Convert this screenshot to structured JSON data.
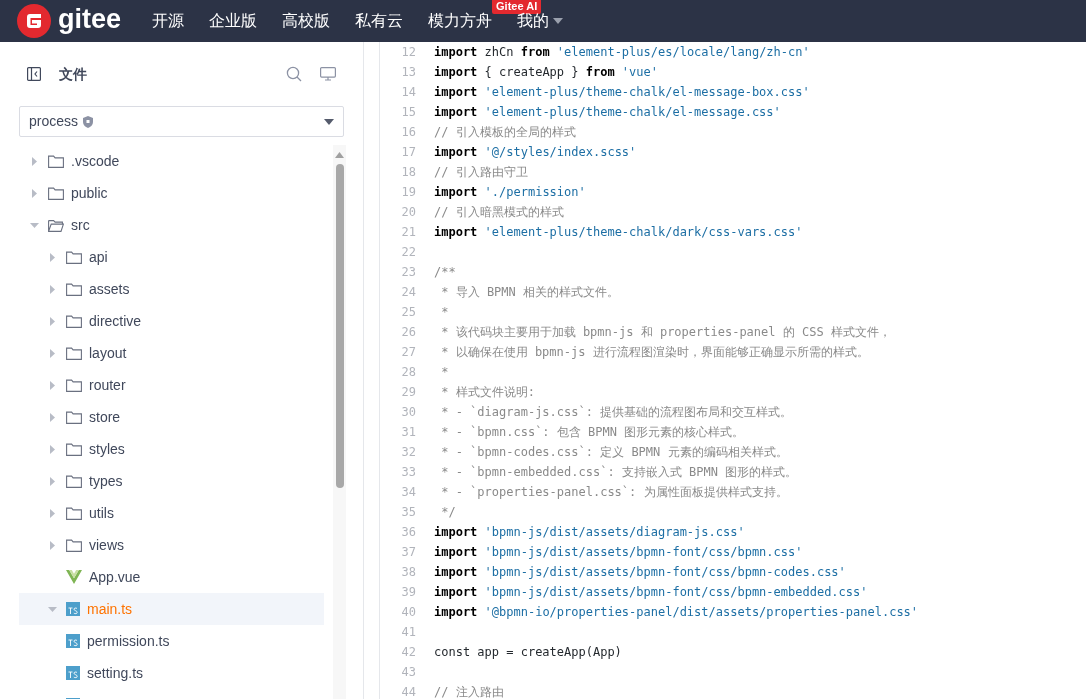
{
  "navbar": {
    "logo": "gitee",
    "items": [
      {
        "label": "开源"
      },
      {
        "label": "企业版"
      },
      {
        "label": "高校版"
      },
      {
        "label": "私有云"
      },
      {
        "label": "模力方舟",
        "badge": "Gitee AI"
      },
      {
        "label": "我的",
        "dropdown": true
      }
    ]
  },
  "sidebar": {
    "title": "文件",
    "branch": "process",
    "tree": [
      {
        "label": ".vscode",
        "kind": "folder",
        "expanded": false,
        "selected": false
      },
      {
        "label": "public",
        "kind": "folder",
        "expanded": false,
        "selected": false
      },
      {
        "label": "src",
        "kind": "folder",
        "expanded": true,
        "selected": false,
        "children": [
          {
            "label": "api",
            "kind": "folder",
            "expanded": false,
            "selected": false
          },
          {
            "label": "assets",
            "kind": "folder",
            "expanded": false,
            "selected": false
          },
          {
            "label": "directive",
            "kind": "folder",
            "expanded": false,
            "selected": false
          },
          {
            "label": "layout",
            "kind": "folder",
            "expanded": false,
            "selected": false
          },
          {
            "label": "router",
            "kind": "folder",
            "expanded": false,
            "selected": false
          },
          {
            "label": "store",
            "kind": "folder",
            "expanded": false,
            "selected": false
          },
          {
            "label": "styles",
            "kind": "folder",
            "expanded": false,
            "selected": false
          },
          {
            "label": "types",
            "kind": "folder",
            "expanded": false,
            "selected": false
          },
          {
            "label": "utils",
            "kind": "folder",
            "expanded": false,
            "selected": false
          },
          {
            "label": "views",
            "kind": "folder",
            "expanded": false,
            "selected": false
          },
          {
            "label": "App.vue",
            "kind": "vue",
            "selected": false
          },
          {
            "label": "main.ts",
            "kind": "ts",
            "expandable": true,
            "expanded": true,
            "selected": true
          },
          {
            "label": "permission.ts",
            "kind": "ts",
            "selected": false
          },
          {
            "label": "setting.ts",
            "kind": "ts",
            "selected": false
          },
          {
            "kind": "ts",
            "selected": false
          }
        ]
      }
    ]
  },
  "code": [
    {
      "number": "12",
      "tokens": [
        {
          "kind": "keyword",
          "text": "import"
        },
        {
          "kind": "plain",
          "text": " zhCn "
        },
        {
          "kind": "keyword",
          "text": "from"
        },
        {
          "kind": "string",
          "text": " 'element-plus/es/locale/lang/zh-cn'"
        }
      ]
    },
    {
      "number": "13",
      "tokens": [
        {
          "kind": "keyword",
          "text": "import"
        },
        {
          "kind": "plain",
          "text": " { createApp } "
        },
        {
          "kind": "keyword",
          "text": "from"
        },
        {
          "kind": "string",
          "text": " 'vue'"
        }
      ]
    },
    {
      "number": "14",
      "tokens": [
        {
          "kind": "keyword",
          "text": "import"
        },
        {
          "kind": "string",
          "text": " 'element-plus/theme-chalk/el-message-box.css'"
        }
      ]
    },
    {
      "number": "15",
      "tokens": [
        {
          "kind": "keyword",
          "text": "import"
        },
        {
          "kind": "string",
          "text": " 'element-plus/theme-chalk/el-message.css'"
        }
      ]
    },
    {
      "number": "16",
      "tokens": [
        {
          "kind": "comment",
          "text": "// 引入模板的全局的样式"
        }
      ]
    },
    {
      "number": "17",
      "tokens": [
        {
          "kind": "keyword",
          "text": "import"
        },
        {
          "kind": "string",
          "text": " '@/styles/index.scss'"
        }
      ]
    },
    {
      "number": "18",
      "tokens": [
        {
          "kind": "comment",
          "text": "// 引入路由守卫"
        }
      ]
    },
    {
      "number": "19",
      "tokens": [
        {
          "kind": "keyword",
          "text": "import"
        },
        {
          "kind": "string",
          "text": " './permission'"
        }
      ]
    },
    {
      "number": "20",
      "tokens": [
        {
          "kind": "comment",
          "text": "// 引入暗黑模式的样式"
        }
      ]
    },
    {
      "number": "21",
      "tokens": [
        {
          "kind": "keyword",
          "text": "import"
        },
        {
          "kind": "string",
          "text": " 'element-plus/theme-chalk/dark/css-vars.css'"
        }
      ]
    },
    {
      "number": "22"
    },
    {
      "number": "23",
      "tokens": [
        {
          "kind": "comment",
          "text": "/**"
        }
      ]
    },
    {
      "number": "24",
      "tokens": [
        {
          "kind": "comment",
          "text": " * 导入 BPMN 相关的样式文件。"
        }
      ]
    },
    {
      "number": "25",
      "tokens": [
        {
          "kind": "comment",
          "text": " *"
        }
      ]
    },
    {
      "number": "26",
      "tokens": [
        {
          "kind": "comment",
          "text": " * 该代码块主要用于加载 bpmn-js 和 properties-panel 的 CSS 样式文件，"
        }
      ]
    },
    {
      "number": "27",
      "tokens": [
        {
          "kind": "comment",
          "text": " * 以确保在使用 bpmn-js 进行流程图渲染时，界面能够正确显示所需的样式。"
        }
      ]
    },
    {
      "number": "28",
      "tokens": [
        {
          "kind": "comment",
          "text": " *"
        }
      ]
    },
    {
      "number": "29",
      "tokens": [
        {
          "kind": "comment",
          "text": " * 样式文件说明:"
        }
      ]
    },
    {
      "number": "30",
      "tokens": [
        {
          "kind": "comment",
          "text": " * - `diagram-js.css`: 提供基础的流程图布局和交互样式。"
        }
      ]
    },
    {
      "number": "31",
      "tokens": [
        {
          "kind": "comment",
          "text": " * - `bpmn.css`: 包含 BPMN 图形元素的核心样式。"
        }
      ]
    },
    {
      "number": "32",
      "tokens": [
        {
          "kind": "comment",
          "text": " * - `bpmn-codes.css`: 定义 BPMN 元素的编码相关样式。"
        }
      ]
    },
    {
      "number": "33",
      "tokens": [
        {
          "kind": "comment",
          "text": " * - `bpmn-embedded.css`: 支持嵌入式 BPMN 图形的样式。"
        }
      ]
    },
    {
      "number": "34",
      "tokens": [
        {
          "kind": "comment",
          "text": " * - `properties-panel.css`: 为属性面板提供样式支持。"
        }
      ]
    },
    {
      "number": "35",
      "tokens": [
        {
          "kind": "comment",
          "text": " */"
        }
      ]
    },
    {
      "number": "36",
      "tokens": [
        {
          "kind": "keyword",
          "text": "import"
        },
        {
          "kind": "string",
          "text": " 'bpmn-js/dist/assets/diagram-js.css'"
        }
      ]
    },
    {
      "number": "37",
      "tokens": [
        {
          "kind": "keyword",
          "text": "import"
        },
        {
          "kind": "string",
          "text": " 'bpmn-js/dist/assets/bpmn-font/css/bpmn.css'"
        }
      ]
    },
    {
      "number": "38",
      "tokens": [
        {
          "kind": "keyword",
          "text": "import"
        },
        {
          "kind": "string",
          "text": " 'bpmn-js/dist/assets/bpmn-font/css/bpmn-codes.css'"
        }
      ]
    },
    {
      "number": "39",
      "tokens": [
        {
          "kind": "keyword",
          "text": "import"
        },
        {
          "kind": "string",
          "text": " 'bpmn-js/dist/assets/bpmn-font/css/bpmn-embedded.css'"
        }
      ]
    },
    {
      "number": "40",
      "tokens": [
        {
          "kind": "keyword",
          "text": "import"
        },
        {
          "kind": "string",
          "text": " '@bpmn-io/properties-panel/dist/assets/properties-panel.css'"
        }
      ]
    },
    {
      "number": "41"
    },
    {
      "number": "42",
      "tokens": [
        {
          "kind": "plain",
          "text": "const app = createApp(App)"
        }
      ]
    },
    {
      "number": "43"
    },
    {
      "number": "44",
      "tokens": [
        {
          "kind": "comment",
          "text": "// 注入路由"
        }
      ]
    }
  ]
}
